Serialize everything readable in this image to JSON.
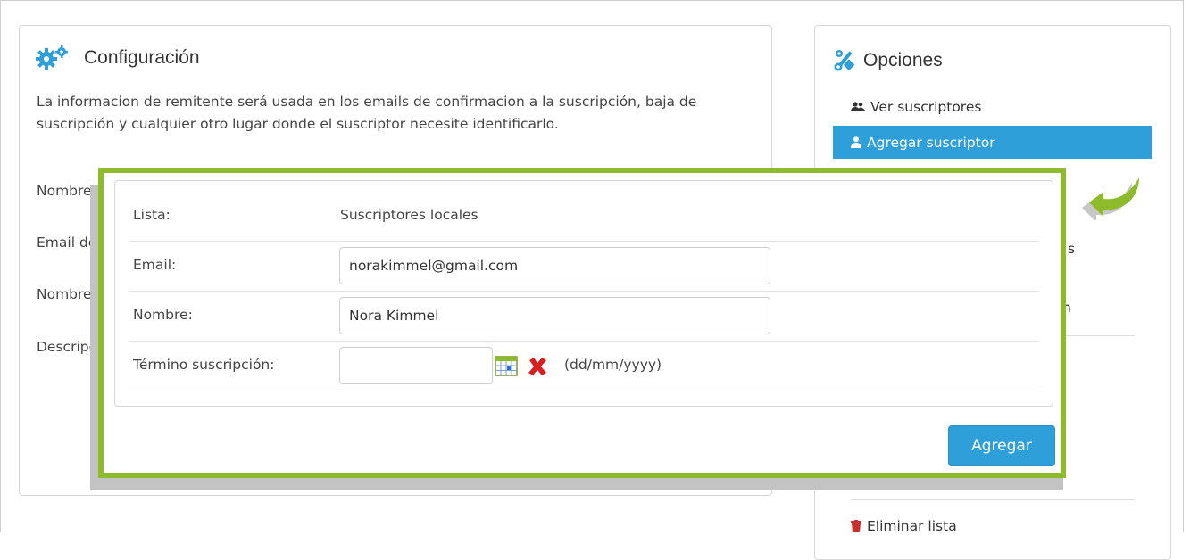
{
  "config": {
    "title": "Configuración",
    "description": "La informacion de remitente será usada en los emails de confirmacion a la suscripción, baja de suscripción y cualquier otro lugar donde el suscriptor necesite identificarlo.",
    "fields": [
      "Nombre",
      "Email de",
      "Nombre",
      "Descripc"
    ]
  },
  "options": {
    "title": "Opciones",
    "items": [
      {
        "label": "Ver suscriptores",
        "icon": "users-icon"
      },
      {
        "label": "Agregar suscriptor",
        "icon": "user-icon",
        "active": true
      }
    ],
    "fragments": [
      "s",
      "n"
    ],
    "delete_label": "Eliminar lista"
  },
  "form": {
    "list_label": "Lista:",
    "list_value": "Suscriptores locales",
    "email_label": "Email:",
    "email_value": "norakimmel@gmail.com",
    "name_label": "Nombre:",
    "name_value": "Nora Kimmel",
    "term_label": "Término suscripción:",
    "term_value": "",
    "date_hint": "(dd/mm/yyyy)",
    "submit_label": "Agregar"
  },
  "colors": {
    "accent": "#2e9fd8",
    "highlight_border": "#8dbb2c",
    "delete_red": "#c9302c"
  }
}
